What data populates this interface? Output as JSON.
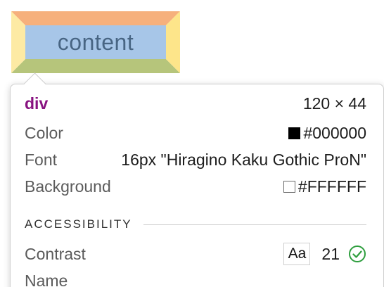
{
  "box_model": {
    "content_label": "content",
    "colors": {
      "margin": "#F6B07C",
      "border": "#FDEAA4",
      "padding": "#B6C57B",
      "content": "#A7C6E8",
      "content_text": "#486583"
    }
  },
  "tooltip": {
    "element": {
      "tag": "div",
      "size": "120 × 44"
    },
    "properties": [
      {
        "label": "Color",
        "value": "#000000",
        "swatch": "black"
      },
      {
        "label": "Font",
        "value": "16px \"Hiragino Kaku Gothic ProN\""
      },
      {
        "label": "Background",
        "value": "#FFFFFF",
        "swatch": "white"
      }
    ],
    "accessibility": {
      "header": "ACCESSIBILITY",
      "contrast_label": "Contrast",
      "contrast_sample": "Aa",
      "contrast_value": "21",
      "contrast_status_icon": "check-circle-icon",
      "contrast_status_color": "#2E9E3E",
      "name_label": "Name"
    }
  }
}
